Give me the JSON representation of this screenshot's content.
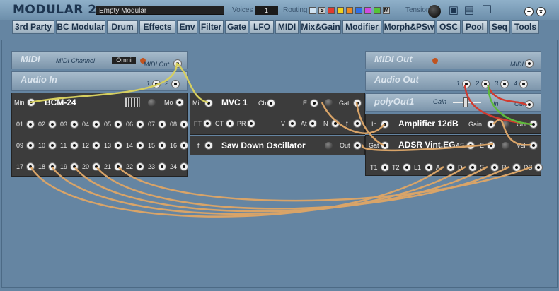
{
  "app": {
    "title": "MODULAR 2",
    "patch_name": "Empty Modular"
  },
  "toolbar": {
    "voices_label": "Voices",
    "voices_value": "1",
    "routing_label": "Routing",
    "tension_label": "Tension",
    "routing_swatches": [
      {
        "label": "",
        "color": "#cfe3f2"
      },
      {
        "label": "S",
        "color": "#cccccc"
      },
      {
        "label": "",
        "color": "#e23b2e"
      },
      {
        "label": "",
        "color": "#f2d21e"
      },
      {
        "label": "",
        "color": "#f08a1e"
      },
      {
        "label": "",
        "color": "#2f6ee8"
      },
      {
        "label": "",
        "color": "#d04be0"
      },
      {
        "label": "",
        "color": "#55c437"
      },
      {
        "label": "M",
        "color": "#cccccc"
      }
    ],
    "icons": [
      "save-icon",
      "save-as-icon",
      "font-icon",
      "copy-icon"
    ],
    "minimize": "–",
    "close": "x"
  },
  "categories": [
    "3rd Party",
    "BC Modular",
    "Drum",
    "Effects",
    "Env",
    "Filter",
    "Gate",
    "LFO",
    "MIDI",
    "Mix&Gain",
    "Modifier",
    "Morph&PSw",
    "OSC",
    "Pool",
    "Seq",
    "Tools"
  ],
  "midi_bar": {
    "title": "MIDI",
    "channel_label": "MIDI Channel",
    "channel_value": "Omni",
    "out_label": "MIDI Out"
  },
  "audio_in_bar": {
    "title": "Audio In",
    "port1": "1",
    "port2": "2"
  },
  "midi_out_bar": {
    "title": "MIDI Out",
    "in_label": "MIDI"
  },
  "audio_out_bar": {
    "title": "Audio Out",
    "ports": [
      "1",
      "2",
      "3",
      "4"
    ]
  },
  "polyout_bar": {
    "title": "polyOut1",
    "gain_label": "Gain",
    "in_label": "In",
    "out_label": "Out"
  },
  "bcm24": {
    "name": "BCM-24",
    "min_label": "Min",
    "mo_label": "Mo",
    "row1": [
      "01",
      "02",
      "03",
      "04",
      "05",
      "06",
      "07",
      "08"
    ],
    "row2": [
      "09",
      "10",
      "11",
      "12",
      "13",
      "14",
      "15",
      "16"
    ],
    "row3": [
      "17",
      "18",
      "19",
      "20",
      "21",
      "22",
      "23",
      "24"
    ]
  },
  "mvc1": {
    "name": "MVC 1",
    "min": "Min",
    "ch": "Ch",
    "e": "E",
    "gat": "Gat",
    "ft": "FT",
    "ct": "CT",
    "pr": "PR",
    "v": "V",
    "at": "At",
    "n": "N",
    "f": "f"
  },
  "saw": {
    "name": "Saw Down Oscillator",
    "f": "f",
    "out": "Out"
  },
  "amp": {
    "name": "Amplifier 12dB",
    "in": "In",
    "gain": "Gain",
    "out": "Out"
  },
  "adsr": {
    "name": "ADSR Vint.EG",
    "gat": "Gat",
    "as": "AS",
    "e": "E",
    "vel": "Vel",
    "bottom": [
      "T1",
      "T2",
      "L1",
      "A",
      "D",
      "S",
      "R",
      "DS"
    ]
  },
  "colors": {
    "cable": "#d9a468",
    "cable_yellow": "#d6cf5f",
    "cable_red": "#d23a2e",
    "cable_green": "#5dba3d",
    "titlebar": "#1d3550"
  }
}
